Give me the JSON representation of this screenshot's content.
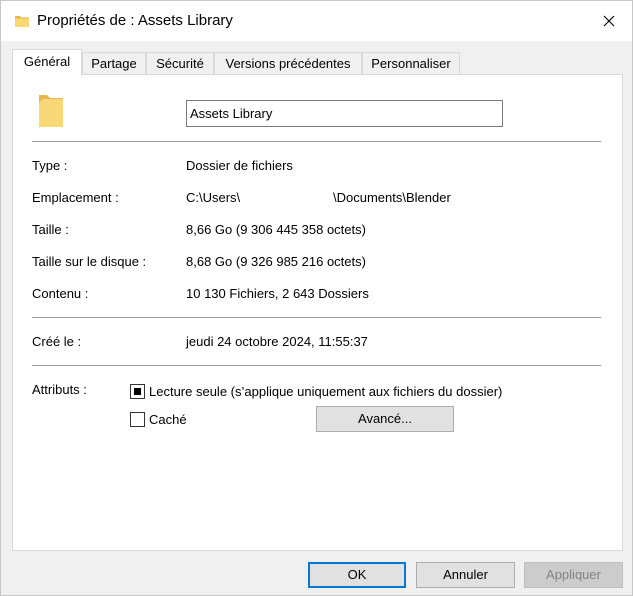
{
  "window": {
    "title": "Propriétés de : Assets Library"
  },
  "tabs": [
    {
      "label": "Général",
      "active": true
    },
    {
      "label": "Partage",
      "active": false
    },
    {
      "label": "Sécurité",
      "active": false
    },
    {
      "label": "Versions précédentes",
      "active": false
    },
    {
      "label": "Personnaliser",
      "active": false
    }
  ],
  "general": {
    "folder_name": "Assets Library",
    "type": {
      "label": "Type :",
      "value": "Dossier de fichiers"
    },
    "location": {
      "label": "Emplacement :",
      "value_left": "C:\\Users\\",
      "value_right": "\\Documents\\Blender"
    },
    "size": {
      "label": "Taille :",
      "value": "8,66 Go (9 306 445 358 octets)"
    },
    "size_on_disk": {
      "label": "Taille sur le disque :",
      "value": "8,68 Go (9 326 985 216 octets)"
    },
    "contents": {
      "label": "Contenu :",
      "value": "10 130 Fichiers, 2 643 Dossiers"
    },
    "created": {
      "label": "Créé le :",
      "value": "jeudi 24 octobre 2024, 11:55:37"
    },
    "attributes": {
      "label": "Attributs :",
      "readonly": {
        "label": "Lecture seule (s’applique uniquement aux fichiers du dossier)",
        "state": "indeterminate"
      },
      "hidden": {
        "label": "Caché",
        "state": "unchecked"
      },
      "advanced_label": "Avancé..."
    }
  },
  "buttons": {
    "ok": "OK",
    "cancel": "Annuler",
    "apply": "Appliquer"
  },
  "colors": {
    "accent": "#0078d7",
    "folder": "#f8d775",
    "folder_dark": "#e8b64a"
  }
}
